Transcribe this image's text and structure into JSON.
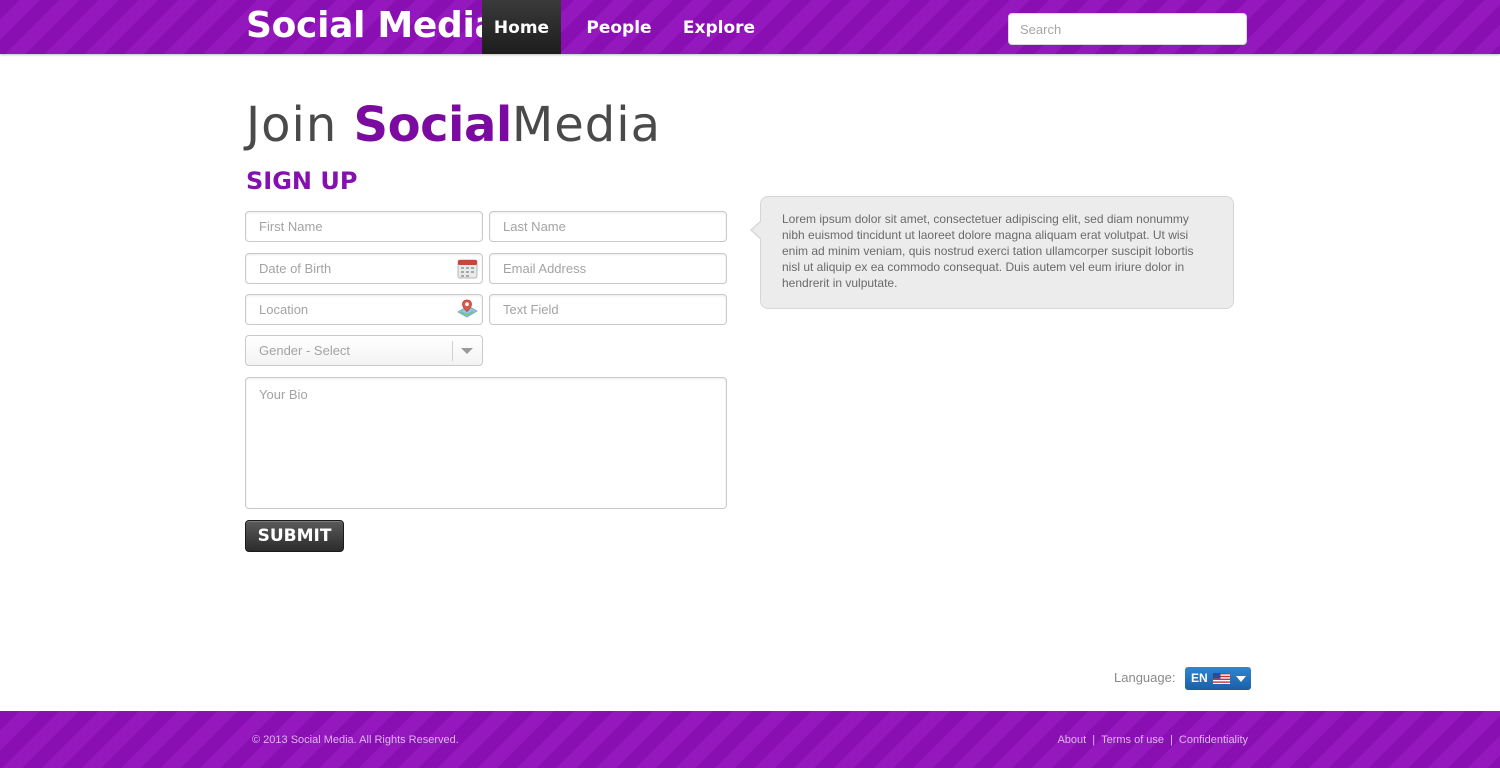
{
  "header": {
    "logo": "Social Media",
    "nav": [
      {
        "label": "Home",
        "active": true
      },
      {
        "label": "People",
        "active": false
      },
      {
        "label": "Explore",
        "active": false
      }
    ],
    "search_placeholder": "Search"
  },
  "main": {
    "title_prefix": "Join ",
    "title_bold": "Social",
    "title_suffix": "Media",
    "subtitle": "SIGN UP",
    "form": {
      "first_name_placeholder": "First Name",
      "last_name_placeholder": "Last Name",
      "dob_placeholder": "Date of Birth",
      "email_placeholder": "Email Address",
      "location_placeholder": "Location",
      "text_field_placeholder": "Text Field",
      "gender_selected": "Gender - Select",
      "bio_placeholder": "Your Bio",
      "submit_label": "SUBMIT",
      "icons": [
        "calendar-icon",
        "map-pin-icon",
        "chevron-down-icon"
      ]
    },
    "info_text": "Lorem ipsum dolor sit amet, consectetuer adipiscing elit, sed diam nonummy nibh euismod tincidunt ut laoreet dolore magna aliquam erat volutpat. Ut wisi enim ad minim veniam, quis nostrud exerci tation ullamcorper suscipit lobortis nisl ut aliquip ex ea commodo consequat. Duis autem vel eum iriure dolor in hendrerit in vulputate."
  },
  "language": {
    "label": "Language:",
    "code": "EN",
    "flag_icon": "us-flag-icon"
  },
  "footer": {
    "copyright": "© 2013 Social Media. All Rights Reserved.",
    "links": [
      "About",
      "Terms of use",
      "Confidentiality"
    ],
    "separator": "|"
  },
  "colors": {
    "brand_purple": "#8a0fb3",
    "title_purple": "#7b0aa0",
    "nav_active_bg": "#2a2a2a",
    "language_blue": "#2a7cc7"
  }
}
